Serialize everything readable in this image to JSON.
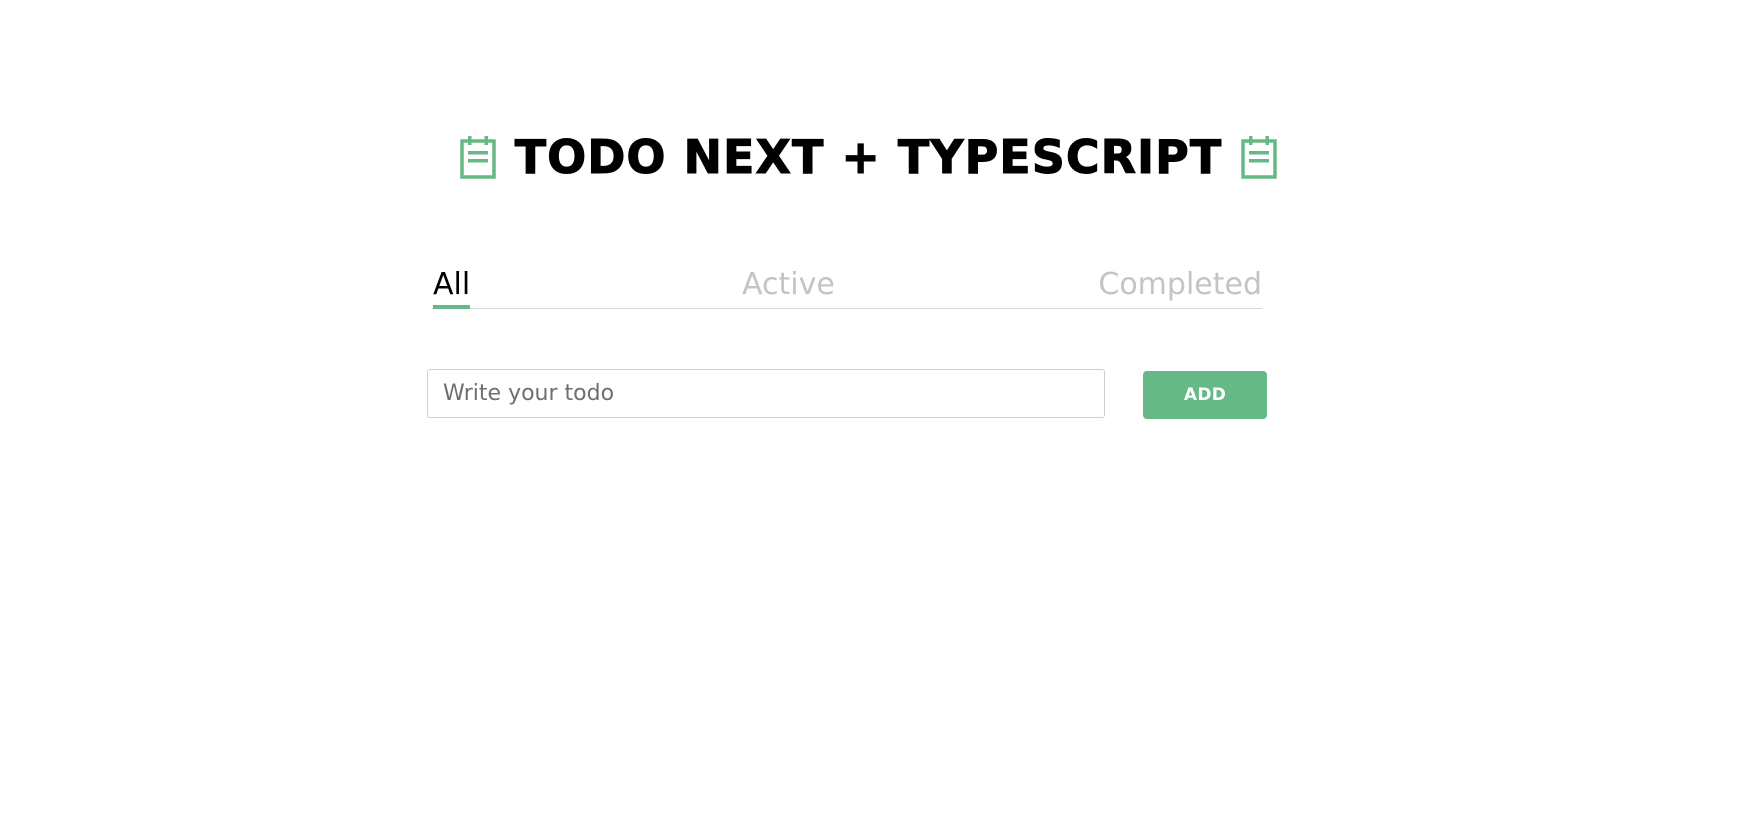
{
  "header": {
    "title": "TODO NEXT + TYPESCRIPT",
    "icon_left": "notepad-icon",
    "icon_right": "notepad-icon"
  },
  "tabs": [
    {
      "label": "All",
      "selected": true
    },
    {
      "label": "Active",
      "selected": false
    },
    {
      "label": "Completed",
      "selected": false
    }
  ],
  "form": {
    "input_value": "",
    "input_placeholder": "Write your todo",
    "add_label": "ADD"
  },
  "colors": {
    "accent": "#66b886",
    "inactive_tab": "#c4c4c4",
    "text": "#000000"
  }
}
